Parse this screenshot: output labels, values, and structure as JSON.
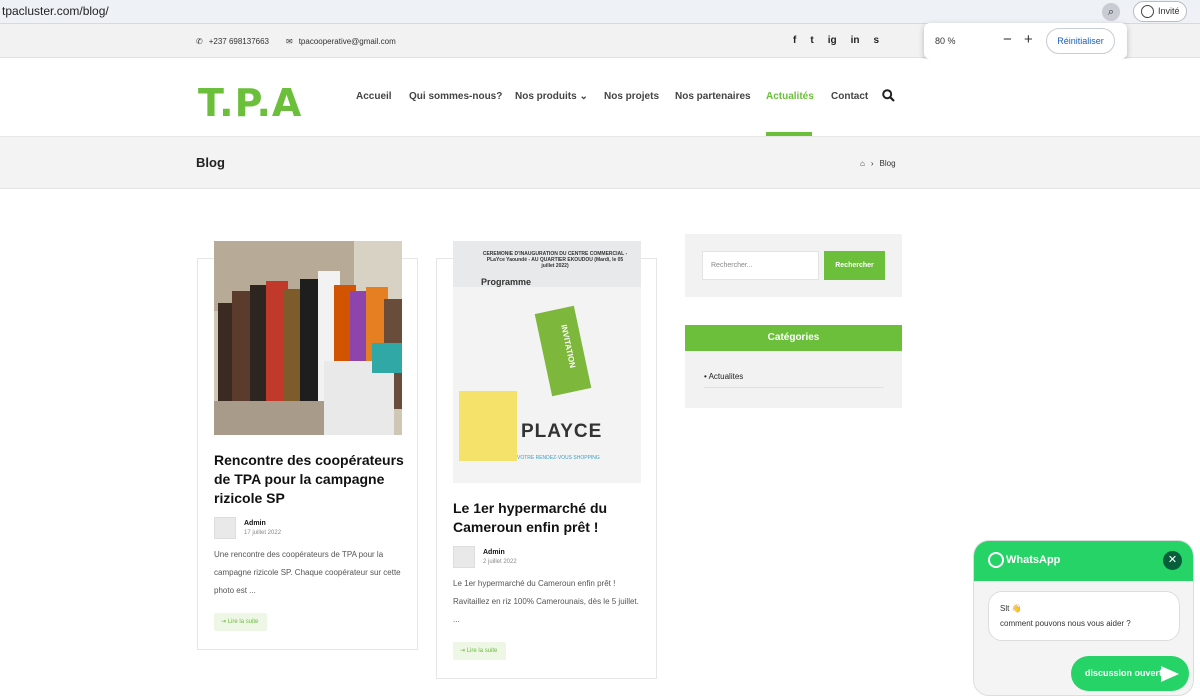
{
  "browser": {
    "url": "tpacluster.com/blog/",
    "guest_label": "Invité"
  },
  "zoom": {
    "percent": "80 %",
    "minus": "−",
    "plus": "+",
    "reset_label": "Réinitialiser"
  },
  "topbar": {
    "phone": "+237 698137663",
    "email": "tpacooperative@gmail.com",
    "socials": [
      "f",
      "t",
      "ig",
      "in",
      "s"
    ]
  },
  "header": {
    "logo_text": "T.P.A",
    "nav": [
      "Accueil",
      "Qui sommes-nous?",
      "Nos produits",
      "Nos projets",
      "Nos partenaires",
      "Actualités",
      "Contact"
    ],
    "active_nav": "Actualités"
  },
  "breadcrumb": {
    "page_title": "Blog",
    "current": "Blog"
  },
  "posts": [
    {
      "title": "Rencontre des coopérateurs de TPA pour la campagne rizicole SP",
      "author": "Admin",
      "date": "17 juillet 2022",
      "excerpt": "Une rencontre des coopérateurs de TPA pour la campagne rizicole SP. Chaque coopérateur sur cette photo est ...",
      "read_more": "Lire la suite"
    },
    {
      "title": "Le 1er hypermarché du Cameroun enfin prêt !",
      "author": "Admin",
      "date": "2 juillet 2022",
      "excerpt": "Le 1er hypermarché du Cameroun enfin prêt ! Ravitaillez en riz 100% Camerounais, dès le 5 juillet. ...",
      "read_more": "Lire la suite",
      "image_text": {
        "banner": "CEREMONIE D'INAUGURATION DU CENTRE COMMERCIAL - PLaYce Yaoundé - AU QUARTIER EKOUDOU (Mardi, le 05 juillet 2022)",
        "programme": "Programme",
        "tag": "INVITATION",
        "brand": "PLAYCE",
        "slogan": "VOTRE RENDEZ-VOUS SHOPPING"
      }
    }
  ],
  "sidebar": {
    "search_placeholder": "Rechercher...",
    "search_button": "Rechercher",
    "categories_title": "Catégories",
    "categories": [
      "Actualites"
    ]
  },
  "whatsapp": {
    "title": "WhatsApp",
    "greeting": "Slt 👋",
    "message": "comment pouvons nous vous aider ?",
    "button": "discussion ouvert"
  },
  "colors": {
    "accent": "#6bbf3b",
    "whatsapp": "#25d366"
  }
}
